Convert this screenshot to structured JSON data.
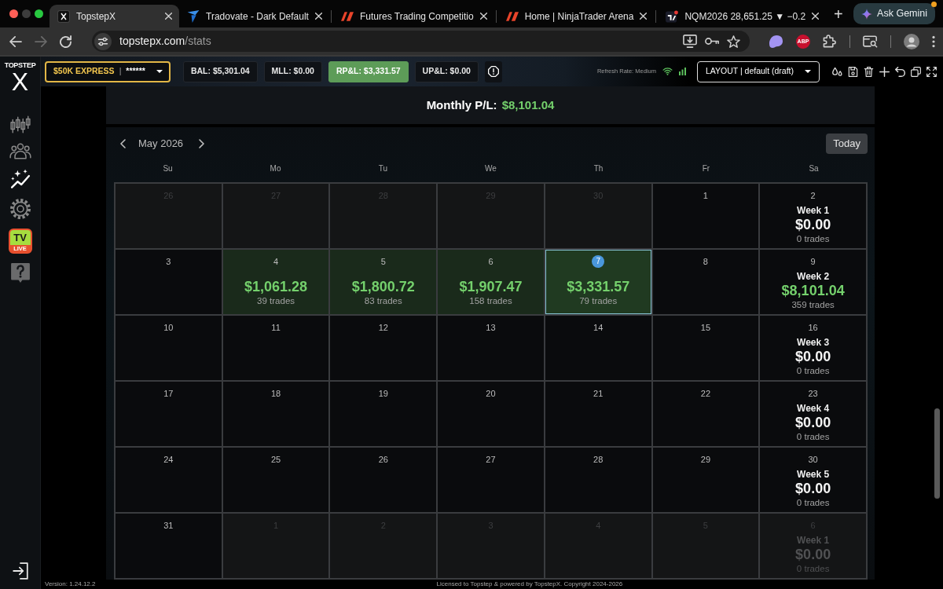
{
  "browser": {
    "tabs": [
      {
        "title": "TopstepX",
        "kind": "x-square",
        "selected": true
      },
      {
        "title": "Tradovate - Dark Default",
        "kind": "wing",
        "selected": false
      },
      {
        "title": "Futures Trading Competitio",
        "kind": "slanted-bars",
        "selected": false
      },
      {
        "title": "Home | NinjaTrader Arena",
        "kind": "slanted-bars",
        "selected": false
      },
      {
        "title": "NQM2026 28,651.25 ▼ −0.2",
        "kind": "chart-square",
        "selected": false
      }
    ],
    "new_tab": "+",
    "assistant_button": "Ask Gemini",
    "forward_disabled": true,
    "url": {
      "host": "topstepx.com",
      "path": "/stats"
    },
    "extension_badge": "ABP"
  },
  "logo": {
    "wordmark": "TOPSTEP",
    "mark": "X"
  },
  "sidebar": {
    "items": [
      {
        "kind": "candles",
        "selected": false
      },
      {
        "kind": "people",
        "selected": false
      },
      {
        "kind": "sparkle-chart",
        "selected": true
      },
      {
        "kind": "gear",
        "selected": false
      },
      {
        "kind": "live-tv",
        "selected": false,
        "badge_top": "TV",
        "badge_bottom": "LIVE"
      },
      {
        "kind": "help",
        "selected": false
      }
    ]
  },
  "toolbar": {
    "account": {
      "name": "$50K EXPRESS",
      "separator": "|",
      "mask": "******"
    },
    "stats": [
      {
        "text": "BAL: $5,301.04",
        "highlighted": false
      },
      {
        "text": "MLL: $0.00",
        "highlighted": false
      },
      {
        "text": "RP&L: $3,331.57",
        "highlighted": true
      },
      {
        "text": "UP&L: $0.00",
        "highlighted": false
      }
    ],
    "refresh_rate": "Refresh Rate: Medium",
    "layout": "LAYOUT | default (draft)"
  },
  "calendar": {
    "monthly_label": "Monthly P/L:",
    "monthly_value": "$8,101.04",
    "monthly_gain": true,
    "month": "May 2026",
    "today_button": "Today",
    "weekdays": [
      "Su",
      "Mo",
      "Tu",
      "We",
      "Th",
      "Fr",
      "Sa"
    ],
    "weeks": [
      {
        "days": [
          {
            "date": "26",
            "in_month": false,
            "today": false
          },
          {
            "date": "27",
            "in_month": false,
            "today": false
          },
          {
            "date": "28",
            "in_month": false,
            "today": false
          },
          {
            "date": "29",
            "in_month": false,
            "today": false
          },
          {
            "date": "30",
            "in_month": false,
            "today": false
          },
          {
            "date": "1",
            "in_month": true,
            "today": false
          },
          {
            "date": "2",
            "in_month": true,
            "today": false
          }
        ],
        "summary": {
          "label": "Week 1",
          "total": "$0.00",
          "trades": "0 trades",
          "gain": false
        }
      },
      {
        "days": [
          {
            "date": "3",
            "in_month": true,
            "today": false
          },
          {
            "date": "4",
            "in_month": true,
            "today": false,
            "pnl": "$1,061.28",
            "trades": "39 trades",
            "gain": true
          },
          {
            "date": "5",
            "in_month": true,
            "today": false,
            "pnl": "$1,800.72",
            "trades": "83 trades",
            "gain": true
          },
          {
            "date": "6",
            "in_month": true,
            "today": false,
            "pnl": "$1,907.47",
            "trades": "158 trades",
            "gain": true
          },
          {
            "date": "7",
            "in_month": true,
            "today": true,
            "pnl": "$3,331.57",
            "trades": "79 trades",
            "gain": true
          },
          {
            "date": "8",
            "in_month": true,
            "today": false
          },
          {
            "date": "9",
            "in_month": true,
            "today": false
          }
        ],
        "summary": {
          "label": "Week 2",
          "total": "$8,101.04",
          "trades": "359 trades",
          "gain": true
        }
      },
      {
        "days": [
          {
            "date": "10",
            "in_month": true,
            "today": false
          },
          {
            "date": "11",
            "in_month": true,
            "today": false
          },
          {
            "date": "12",
            "in_month": true,
            "today": false
          },
          {
            "date": "13",
            "in_month": true,
            "today": false
          },
          {
            "date": "14",
            "in_month": true,
            "today": false
          },
          {
            "date": "15",
            "in_month": true,
            "today": false
          },
          {
            "date": "16",
            "in_month": true,
            "today": false
          }
        ],
        "summary": {
          "label": "Week 3",
          "total": "$0.00",
          "trades": "0 trades",
          "gain": false
        }
      },
      {
        "days": [
          {
            "date": "17",
            "in_month": true,
            "today": false
          },
          {
            "date": "18",
            "in_month": true,
            "today": false
          },
          {
            "date": "19",
            "in_month": true,
            "today": false
          },
          {
            "date": "20",
            "in_month": true,
            "today": false
          },
          {
            "date": "21",
            "in_month": true,
            "today": false
          },
          {
            "date": "22",
            "in_month": true,
            "today": false
          },
          {
            "date": "23",
            "in_month": true,
            "today": false
          }
        ],
        "summary": {
          "label": "Week 4",
          "total": "$0.00",
          "trades": "0 trades",
          "gain": false
        }
      },
      {
        "days": [
          {
            "date": "24",
            "in_month": true,
            "today": false
          },
          {
            "date": "25",
            "in_month": true,
            "today": false
          },
          {
            "date": "26",
            "in_month": true,
            "today": false
          },
          {
            "date": "27",
            "in_month": true,
            "today": false
          },
          {
            "date": "28",
            "in_month": true,
            "today": false
          },
          {
            "date": "29",
            "in_month": true,
            "today": false
          },
          {
            "date": "30",
            "in_month": true,
            "today": false
          }
        ],
        "summary": {
          "label": "Week 5",
          "total": "$0.00",
          "trades": "0 trades",
          "gain": false
        }
      },
      {
        "days": [
          {
            "date": "31",
            "in_month": true,
            "today": false
          },
          {
            "date": "1",
            "in_month": false,
            "today": false
          },
          {
            "date": "2",
            "in_month": false,
            "today": false
          },
          {
            "date": "3",
            "in_month": false,
            "today": false
          },
          {
            "date": "4",
            "in_month": false,
            "today": false
          },
          {
            "date": "5",
            "in_month": false,
            "today": false
          },
          {
            "date": "6",
            "in_month": false,
            "today": false
          }
        ],
        "summary": {
          "label": "Week 1",
          "total": "$0.00",
          "trades": "0 trades",
          "gain": false
        }
      }
    ]
  },
  "footer": {
    "version": "Version: 1.24.12.2",
    "license": "Licensed to Topstep & powered by TopstepX. Copyright 2024-2026"
  }
}
